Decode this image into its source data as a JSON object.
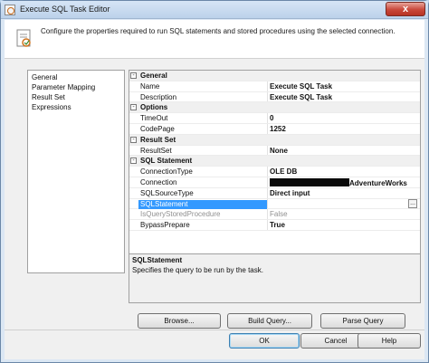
{
  "window": {
    "title": "Execute SQL Task Editor",
    "close_glyph": "x"
  },
  "header": {
    "text": "Configure the properties required to run SQL statements and stored procedures using the selected connection."
  },
  "nav": {
    "items": [
      "General",
      "Parameter Mapping",
      "Result Set",
      "Expressions"
    ]
  },
  "grid": {
    "categories": [
      {
        "name": "General",
        "rows": [
          {
            "label": "Name",
            "value": "Execute SQL Task"
          },
          {
            "label": "Description",
            "value": "Execute SQL Task"
          }
        ]
      },
      {
        "name": "Options",
        "rows": [
          {
            "label": "TimeOut",
            "value": "0"
          },
          {
            "label": "CodePage",
            "value": "1252"
          }
        ]
      },
      {
        "name": "Result Set",
        "rows": [
          {
            "label": "ResultSet",
            "value": "None"
          }
        ]
      },
      {
        "name": "SQL Statement",
        "rows": [
          {
            "label": "ConnectionType",
            "value": "OLE DB"
          },
          {
            "label": "Connection",
            "value": "AdventureWorks"
          },
          {
            "label": "SQLSourceType",
            "value": "Direct input"
          },
          {
            "label": "SQLStatement",
            "value": ""
          },
          {
            "label": "IsQueryStoredProcedure",
            "value": "False"
          },
          {
            "label": "BypassPrepare",
            "value": "True"
          }
        ]
      }
    ],
    "collapse_glyph": "-",
    "ellipsis_glyph": "..."
  },
  "description": {
    "title": "SQLStatement",
    "text": "Specifies the query to be run by the task."
  },
  "actions": {
    "browse": "Browse...",
    "build_query": "Build Query...",
    "parse_query": "Parse Query"
  },
  "footer": {
    "ok": "OK",
    "cancel": "Cancel",
    "help": "Help"
  },
  "colors": {
    "selection": "#3399ff",
    "close_button": "#c9483a"
  }
}
